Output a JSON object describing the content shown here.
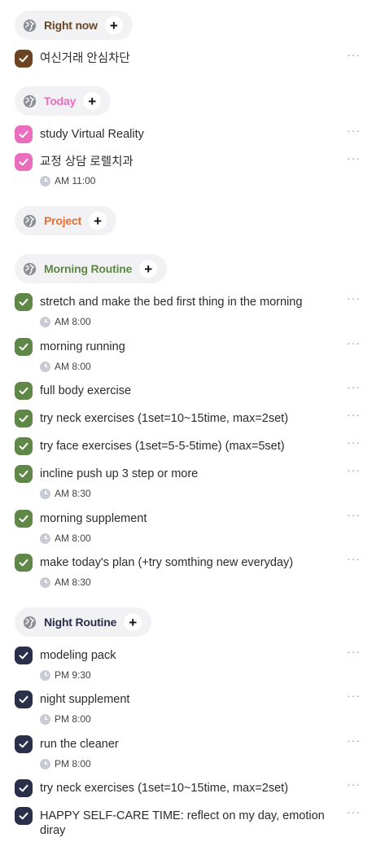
{
  "colors": {
    "right_now": "#6b4523",
    "today": "#ea6dbe",
    "project": "#ec6c2c",
    "morning": "#5f8747",
    "night": "#2a2f4a"
  },
  "icons": {
    "category": "globe-icon",
    "add": "plus-icon",
    "check": "check-icon",
    "time": "clock-icon",
    "more": "more-icon"
  },
  "more_label": "···",
  "categories": {
    "right_now": {
      "label": "Right now",
      "add": "+"
    },
    "today": {
      "label": "Today",
      "add": "+"
    },
    "project": {
      "label": "Project",
      "add": "+"
    },
    "morning": {
      "label": "Morning Routine",
      "add": "+"
    },
    "night": {
      "label": "Night Routine",
      "add": "+"
    }
  },
  "items": {
    "r1": {
      "title": "여신거래 안심차단"
    },
    "t1": {
      "title": "study Virtual Reality"
    },
    "t2": {
      "title": "교정 상담 로렐치과",
      "time": "AM 11:00"
    },
    "m1": {
      "title": "stretch and make the bed first thing in the morning",
      "time": "AM 8:00"
    },
    "m2": {
      "title": "morning running",
      "time": "AM 8:00"
    },
    "m3": {
      "title": "full body exercise"
    },
    "m4": {
      "title": "try neck exercises (1set=10~15time, max=2set)"
    },
    "m5": {
      "title": "try face exercises (1set=5-5-5time) (max=5set)"
    },
    "m6": {
      "title": "incline push up 3 step or more",
      "time": "AM 8:30"
    },
    "m7": {
      "title": "morning supplement",
      "time": "AM 8:00"
    },
    "m8": {
      "title": "make today's plan (+try somthing new everyday)",
      "time": "AM 8:30"
    },
    "n1": {
      "title": "modeling pack",
      "time": "PM 9:30"
    },
    "n2": {
      "title": "night supplement",
      "time": "PM 8:00"
    },
    "n3": {
      "title": "run the cleaner",
      "time": "PM 8:00"
    },
    "n4": {
      "title": "try neck exercises (1set=10~15time, max=2set)"
    },
    "n5": {
      "title": "HAPPY SELF-CARE TIME: reflect on my day, emotion diray"
    }
  }
}
